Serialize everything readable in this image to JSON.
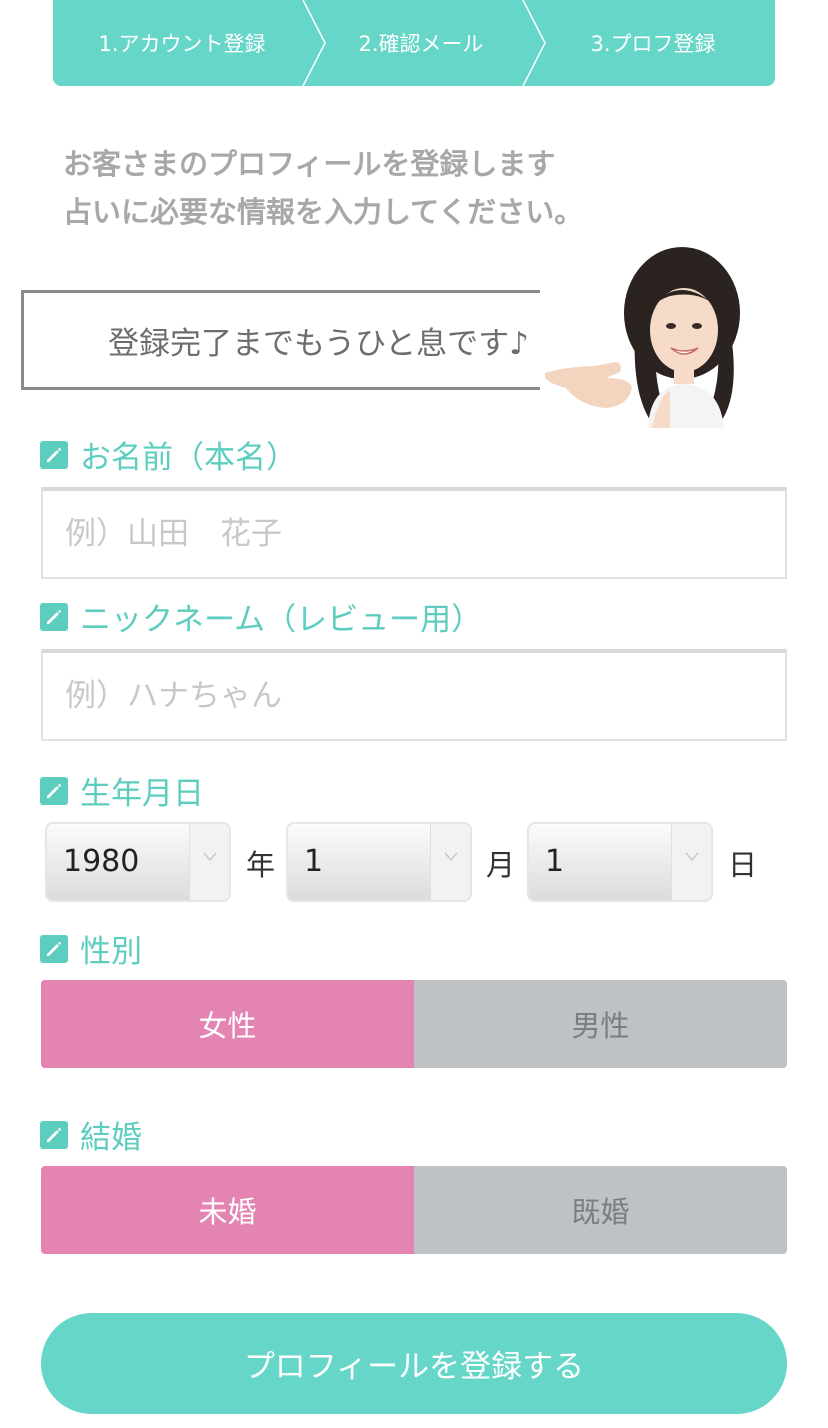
{
  "steps": [
    "1.アカウント登録",
    "2.確認メール",
    "3.プロフ登録"
  ],
  "intro": {
    "line1": "お客さまのプロフィールを登録します",
    "line2": "占いに必要な情報を入力してください。"
  },
  "bubble_text": "登録完了までもうひと息です♪",
  "name_field": {
    "label": "お名前（本名）",
    "placeholder": "例）山田　花子",
    "value": ""
  },
  "nickname_field": {
    "label": "ニックネーム（レビュー用）",
    "placeholder": "例）ハナちゃん",
    "value": ""
  },
  "birthday": {
    "label": "生年月日",
    "year": {
      "value": "1980",
      "unit": "年"
    },
    "month": {
      "value": "1",
      "unit": "月"
    },
    "day": {
      "value": "1",
      "unit": "日"
    }
  },
  "gender": {
    "label": "性別",
    "options": [
      "女性",
      "男性"
    ],
    "selected": "女性"
  },
  "marriage": {
    "label": "結婚",
    "options": [
      "未婚",
      "既婚"
    ],
    "selected": "未婚"
  },
  "submit_label": "プロフィールを登録する",
  "colors": {
    "accent": "#66d6c8",
    "selected": "#e384b2",
    "unselected": "#bec2c5"
  }
}
